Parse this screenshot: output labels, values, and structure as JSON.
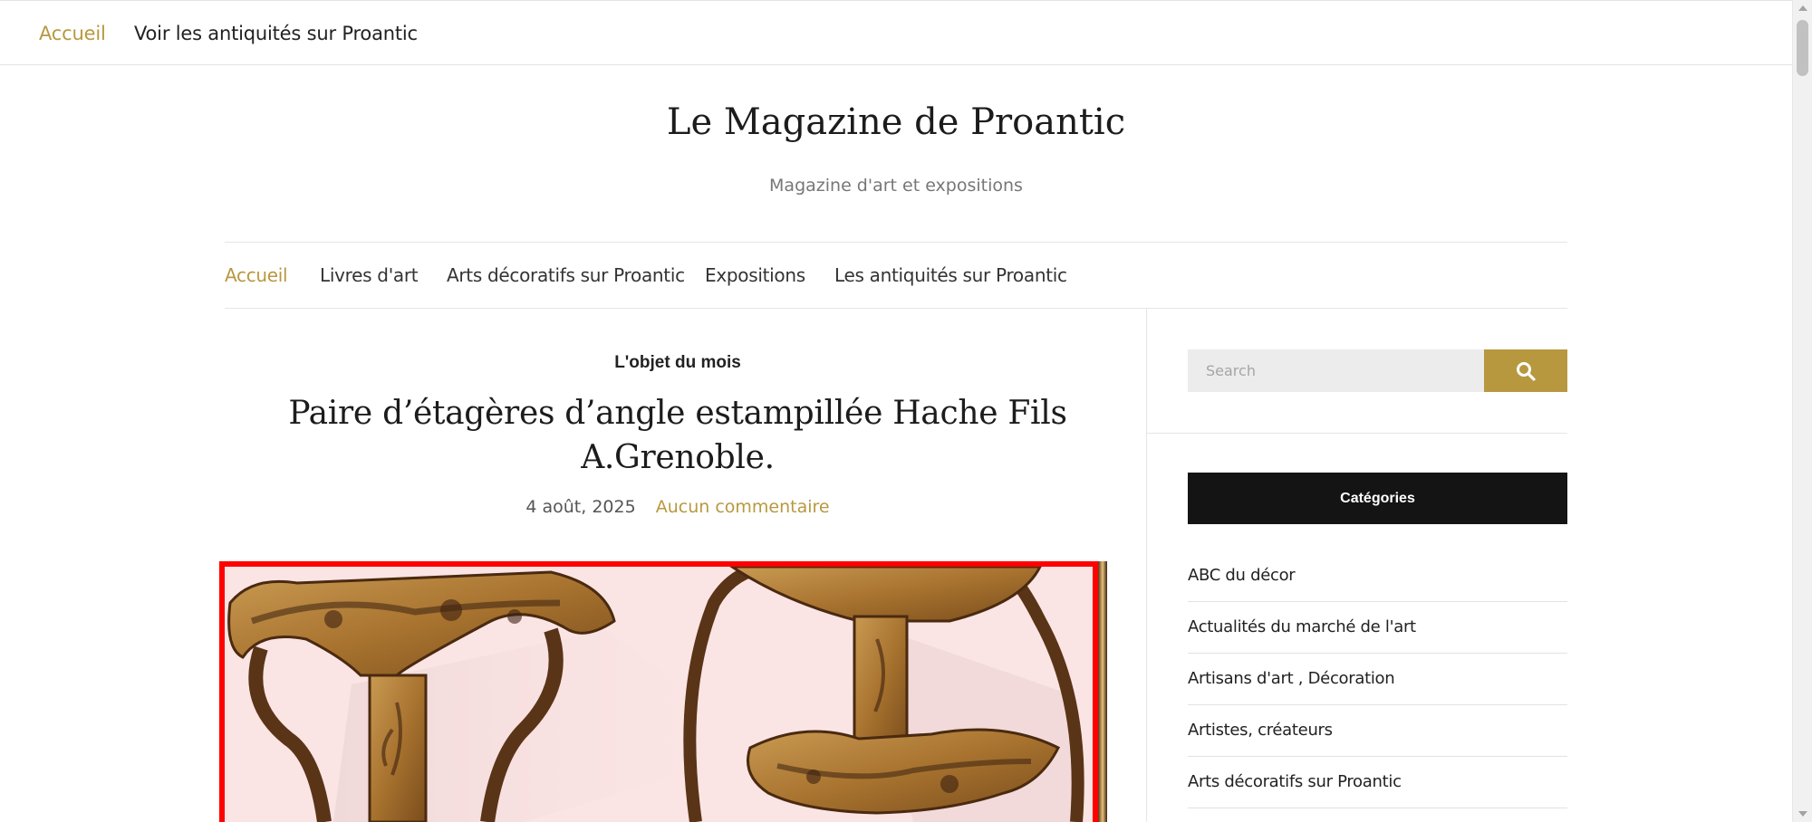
{
  "topbar": {
    "home_label": "Accueil",
    "antiques_label": "Voir les antiquités sur Proantic"
  },
  "site": {
    "title": "Le Magazine de Proantic",
    "tagline": "Magazine d'art et expositions"
  },
  "main_nav": {
    "items": [
      {
        "label": "Accueil"
      },
      {
        "label": "Livres d'art"
      },
      {
        "label": "Arts décoratifs sur Proantic"
      },
      {
        "label": "Expositions"
      },
      {
        "label": "Les antiquités sur Proantic"
      }
    ]
  },
  "post": {
    "category": "L'objet du mois",
    "title": "Paire d’étagères d’angle estampillée Hache Fils A.Grenoble.",
    "date": "4 août, 2025",
    "comments": "Aucun commentaire"
  },
  "sidebar": {
    "search": {
      "placeholder": "Search",
      "button_icon": "search-icon"
    },
    "categories_title": "Catégories",
    "categories": [
      "ABC du décor",
      "Actualités du marché de l'art",
      "Artisans d'art , Décoration",
      "Artistes, créateurs",
      "Arts décoratifs sur Proantic"
    ]
  },
  "colors": {
    "accent": "#b8983f",
    "widget_title_bg": "#141414",
    "image_border": "#ff0000"
  }
}
